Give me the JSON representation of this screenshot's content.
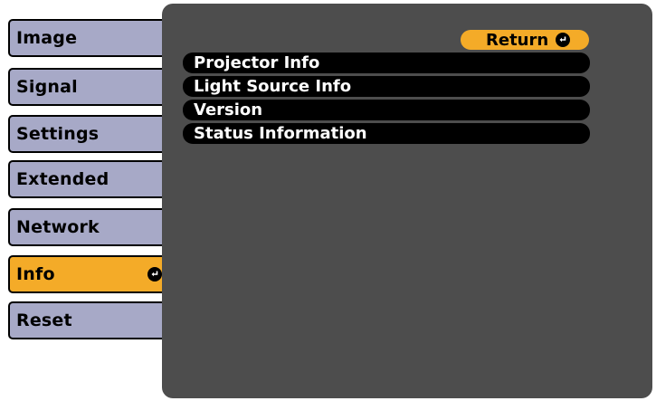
{
  "sidebar": {
    "items": [
      {
        "label": "Image"
      },
      {
        "label": "Signal"
      },
      {
        "label": "Settings"
      },
      {
        "label": "Extended"
      },
      {
        "label": "Network"
      },
      {
        "label": "Info",
        "selected": true
      },
      {
        "label": "Reset"
      }
    ]
  },
  "panel": {
    "return_label": "Return",
    "items": [
      {
        "label": "Projector Info"
      },
      {
        "label": "Light Source Info"
      },
      {
        "label": "Version"
      },
      {
        "label": "Status Information"
      }
    ]
  },
  "colors": {
    "sidebar_item": "#a7a9c7",
    "selected_accent": "#f4ab28",
    "panel_background": "#4d4d4d",
    "menu_item_background": "#000000",
    "menu_item_text": "#ffffff"
  },
  "icons": {
    "enter": "enter-icon"
  }
}
